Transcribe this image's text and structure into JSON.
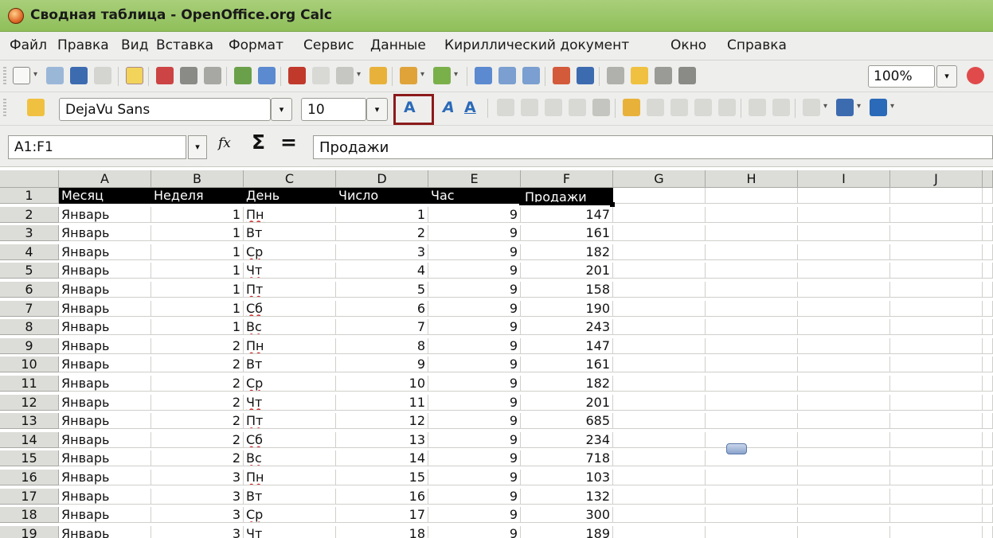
{
  "window": {
    "title": "Сводная таблица - OpenOffice.org Calc"
  },
  "menu": [
    "Файл",
    "Правка",
    "Вид",
    "Вставка",
    "Формат",
    "Сервис",
    "Данные",
    "Кириллический документ",
    "Окно",
    "Справка"
  ],
  "toolbar": {
    "zoom": "100%",
    "font_name": "DejaVu Sans",
    "font_size": "10"
  },
  "formula_bar": {
    "name_box": "A1:F1",
    "formula": "Продажи",
    "fx_label": "fx",
    "sigma": "Σ",
    "equals": "="
  },
  "columns": [
    "A",
    "B",
    "C",
    "D",
    "E",
    "F",
    "G",
    "H",
    "I",
    "J"
  ],
  "sheet": {
    "header": [
      "Месяц",
      "Неделя",
      "День",
      "Число",
      "Час",
      "Продажи"
    ],
    "rows": [
      [
        "Январь",
        "1",
        "Пн",
        "1",
        "9",
        "147"
      ],
      [
        "Январь",
        "1",
        "Вт",
        "2",
        "9",
        "161"
      ],
      [
        "Январь",
        "1",
        "Ср",
        "3",
        "9",
        "182"
      ],
      [
        "Январь",
        "1",
        "Чт",
        "4",
        "9",
        "201"
      ],
      [
        "Январь",
        "1",
        "Пт",
        "5",
        "9",
        "158"
      ],
      [
        "Январь",
        "1",
        "Сб",
        "6",
        "9",
        "190"
      ],
      [
        "Январь",
        "1",
        "Вс",
        "7",
        "9",
        "243"
      ],
      [
        "Январь",
        "2",
        "Пн",
        "8",
        "9",
        "147"
      ],
      [
        "Январь",
        "2",
        "Вт",
        "9",
        "9",
        "161"
      ],
      [
        "Январь",
        "2",
        "Ср",
        "10",
        "9",
        "182"
      ],
      [
        "Январь",
        "2",
        "Чт",
        "11",
        "9",
        "201"
      ],
      [
        "Январь",
        "2",
        "Пт",
        "12",
        "9",
        "685"
      ],
      [
        "Январь",
        "2",
        "Сб",
        "13",
        "9",
        "234"
      ],
      [
        "Январь",
        "2",
        "Вс",
        "14",
        "9",
        "718"
      ],
      [
        "Январь",
        "3",
        "Пн",
        "15",
        "9",
        "103"
      ],
      [
        "Январь",
        "3",
        "Вт",
        "16",
        "9",
        "132"
      ],
      [
        "Январь",
        "3",
        "Ср",
        "17",
        "9",
        "300"
      ],
      [
        "Январь",
        "3",
        "Чт",
        "18",
        "9",
        "189"
      ]
    ]
  }
}
